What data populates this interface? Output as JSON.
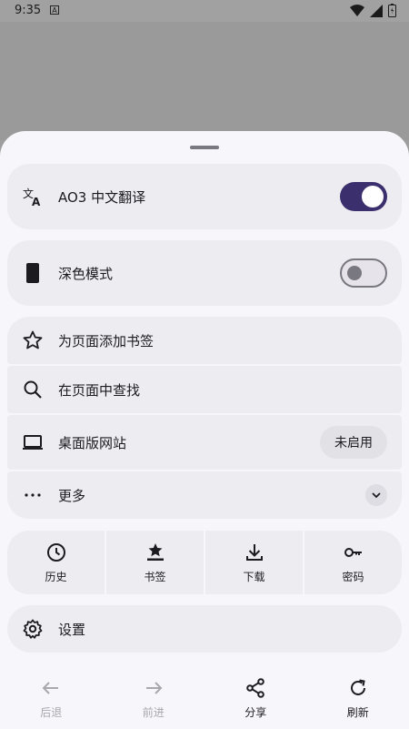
{
  "status_bar": {
    "time": "9:35",
    "notification_glyph": "A"
  },
  "menu": {
    "translate": {
      "label": "AO3 中文翻译",
      "enabled": true
    },
    "dark_mode": {
      "label": "深色模式",
      "enabled": false
    },
    "add_bookmark": {
      "label": "为页面添加书签"
    },
    "find_in_page": {
      "label": "在页面中查找"
    },
    "desktop_site": {
      "label": "桌面版网站",
      "chip": "未启用"
    },
    "more": {
      "label": "更多"
    },
    "settings": {
      "label": "设置"
    }
  },
  "quick_actions": [
    {
      "label": "历史",
      "icon": "clock-icon"
    },
    {
      "label": "书签",
      "icon": "bookmark-star-icon"
    },
    {
      "label": "下载",
      "icon": "download-icon"
    },
    {
      "label": "密码",
      "icon": "key-icon"
    }
  ],
  "bottom_nav": [
    {
      "label": "后退",
      "icon": "arrow-back-icon",
      "enabled": false
    },
    {
      "label": "前进",
      "icon": "arrow-forward-icon",
      "enabled": false
    },
    {
      "label": "分享",
      "icon": "share-icon",
      "enabled": true
    },
    {
      "label": "刷新",
      "icon": "refresh-icon",
      "enabled": true
    }
  ],
  "colors": {
    "sheet_bg": "#f7f6fa",
    "card_bg": "#edecf1",
    "toggle_on": "#3b2f6e",
    "scrim": "#9e9e9e"
  }
}
